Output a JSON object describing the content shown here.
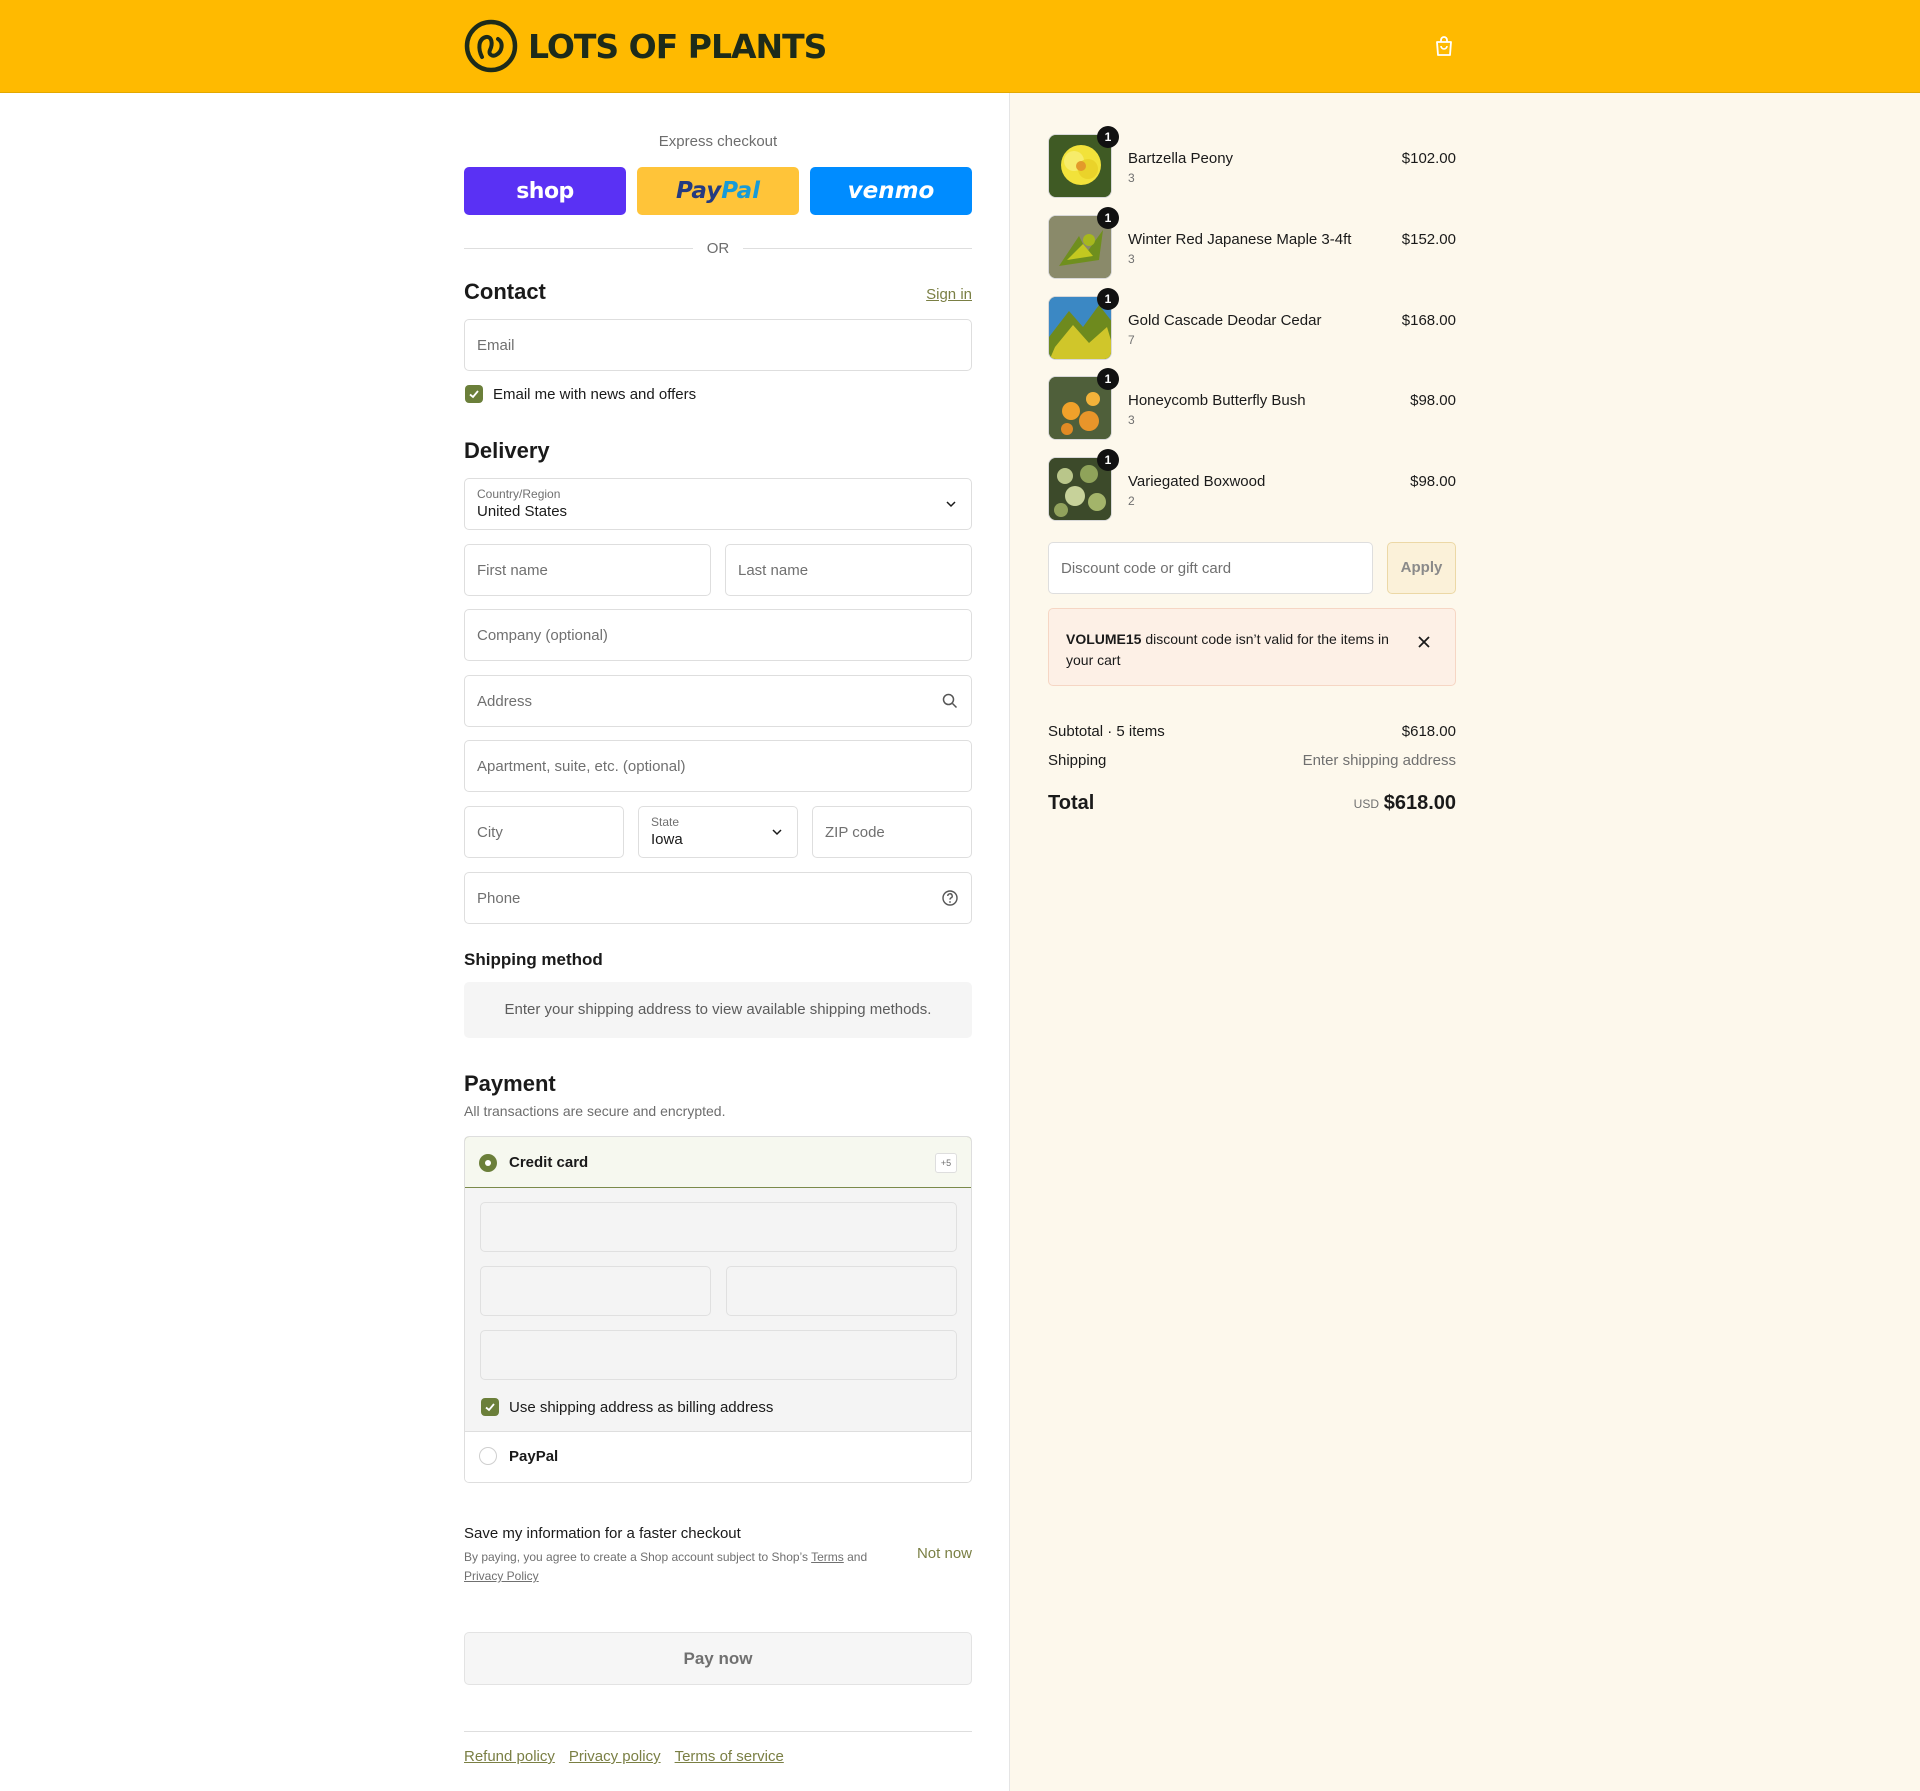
{
  "brand": {
    "name": "LOTS OF PLANTS"
  },
  "colors": {
    "header": "#ffba00",
    "accent": "#6b7f3a",
    "link": "#7a7f44",
    "summary_bg": "#fdf8ec"
  },
  "express": {
    "title": "Express checkout",
    "wallets": {
      "shop": "shop",
      "paypal_a": "Pay",
      "paypal_b": "Pal",
      "venmo": "venmo"
    },
    "or": "OR"
  },
  "contact": {
    "title": "Contact",
    "sign_in": "Sign in",
    "email_placeholder": "Email",
    "news_label": "Email me with news and offers"
  },
  "delivery": {
    "title": "Delivery",
    "country_label": "Country/Region",
    "country_value": "United States",
    "first_name": "First name",
    "last_name": "Last name",
    "company": "Company (optional)",
    "address": "Address",
    "apartment": "Apartment, suite, etc. (optional)",
    "city": "City",
    "state_label": "State",
    "state_value": "Iowa",
    "zip": "ZIP code",
    "phone": "Phone"
  },
  "shipping": {
    "title": "Shipping method",
    "notice": "Enter your shipping address to view available shipping methods."
  },
  "payment": {
    "title": "Payment",
    "subtitle": "All transactions are secure and encrypted.",
    "credit_card": "Credit card",
    "more_badge": "+5",
    "billing_label": "Use shipping address as billing address",
    "paypal": "PayPal"
  },
  "save": {
    "title": "Save my information for a faster checkout",
    "sub_a": "By paying, you agree to create a Shop account subject to Shop’s ",
    "terms": "Terms",
    "sub_b": " and ",
    "privacy": "Privacy Policy",
    "not_now": "Not now"
  },
  "pay_now": "Pay now",
  "footer": {
    "refund": "Refund policy",
    "privacy": "Privacy policy",
    "terms": "Terms of service"
  },
  "cart": {
    "items": [
      {
        "name": "Bartzella Peony",
        "variant": "3",
        "qty": "1",
        "price": "$102.00",
        "icon": "peony-photo"
      },
      {
        "name": "Winter Red Japanese Maple 3-4ft",
        "variant": "3",
        "qty": "1",
        "price": "$152.00",
        "icon": "maple-photo"
      },
      {
        "name": "Gold Cascade Deodar Cedar",
        "variant": "7",
        "qty": "1",
        "price": "$168.00",
        "icon": "cedar-photo"
      },
      {
        "name": "Honeycomb Butterfly Bush",
        "variant": "3",
        "qty": "1",
        "price": "$98.00",
        "icon": "butterfly-bush-photo"
      },
      {
        "name": "Variegated Boxwood",
        "variant": "2",
        "qty": "1",
        "price": "$98.00",
        "icon": "boxwood-photo"
      }
    ],
    "discount_placeholder": "Discount code or gift card",
    "apply": "Apply",
    "alert_code": "VOLUME15",
    "alert_text": " discount code isn’t valid for the items in your cart",
    "subtotal_label": "Subtotal · 5 items",
    "subtotal_value": "$618.00",
    "shipping_label": "Shipping",
    "shipping_value": "Enter shipping address",
    "total_label": "Total",
    "currency": "USD",
    "total_value": "$618.00"
  }
}
